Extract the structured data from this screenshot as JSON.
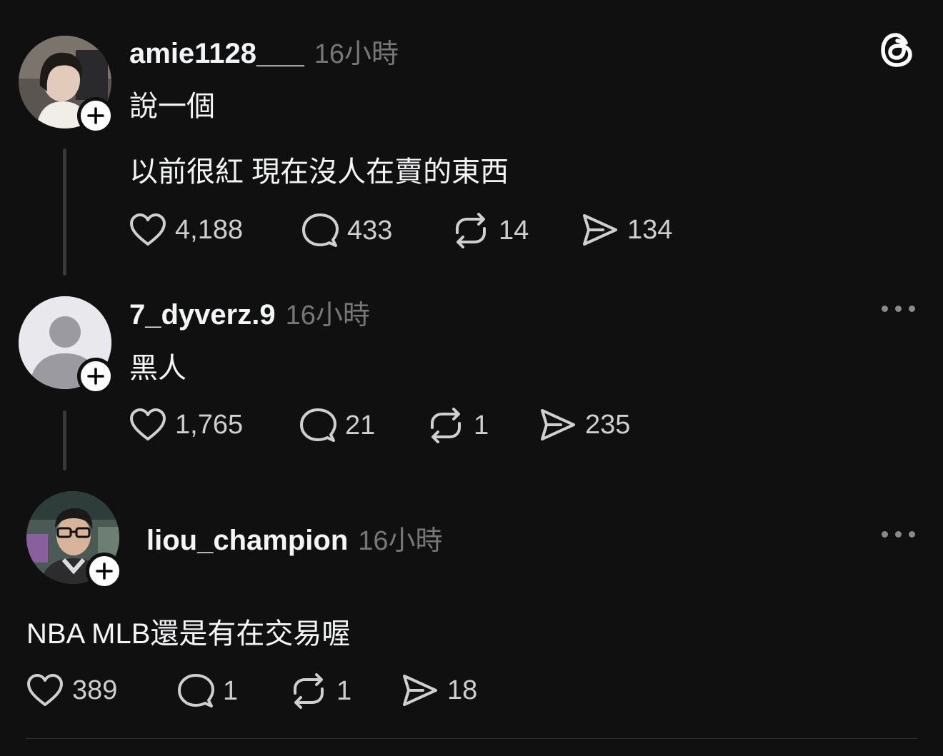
{
  "posts": [
    {
      "username": "amie1128___",
      "time": "16小時",
      "lines": [
        "說一個",
        "以前很紅 現在沒人在賣的東西"
      ],
      "stats": {
        "likes": "4,188",
        "comments": "433",
        "reposts": "14",
        "shares": "134"
      }
    },
    {
      "username": "7_dyverz.9",
      "time": "16小時",
      "lines": [
        "黑人"
      ],
      "stats": {
        "likes": "1,765",
        "comments": "21",
        "reposts": "1",
        "shares": "235"
      }
    },
    {
      "username": "liou_champion",
      "time": "16小時",
      "lines": [
        "NBA MLB還是有在交易喔"
      ],
      "stats": {
        "likes": "389",
        "comments": "1",
        "reposts": "1",
        "shares": "18"
      }
    }
  ],
  "icons": {
    "app": "threads-logo-icon",
    "like": "heart-icon",
    "comment": "comment-bubble-icon",
    "repost": "repost-icon",
    "share": "send-icon",
    "more": "more-dots-icon",
    "follow": "plus-icon"
  },
  "colors": {
    "background": "#101010",
    "text": "#f3f5f7",
    "muted": "#777777"
  }
}
